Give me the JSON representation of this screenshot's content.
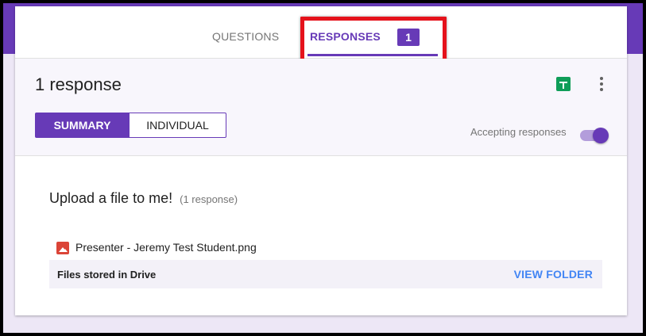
{
  "tabs": {
    "questions_label": "QUESTIONS",
    "responses_label": "RESPONSES",
    "responses_badge": "1"
  },
  "header": {
    "response_count": "1 response",
    "summary_label": "SUMMARY",
    "individual_label": "INDIVIDUAL",
    "accepting_label": "Accepting responses",
    "accepting_on": true
  },
  "question": {
    "title": "Upload a file to me!",
    "count": "(1 response)",
    "file_name": "Presenter - Jeremy Test Student.png",
    "drive_label": "Files stored in Drive",
    "view_folder_label": "VIEW FOLDER"
  },
  "colors": {
    "accent": "#673ab7",
    "highlight": "#e5121b",
    "link": "#4285f4",
    "sheets": "#0f9d58",
    "image_file": "#db4437"
  },
  "icons": [
    "sheets-icon",
    "more-vert-icon",
    "image-file-icon"
  ]
}
